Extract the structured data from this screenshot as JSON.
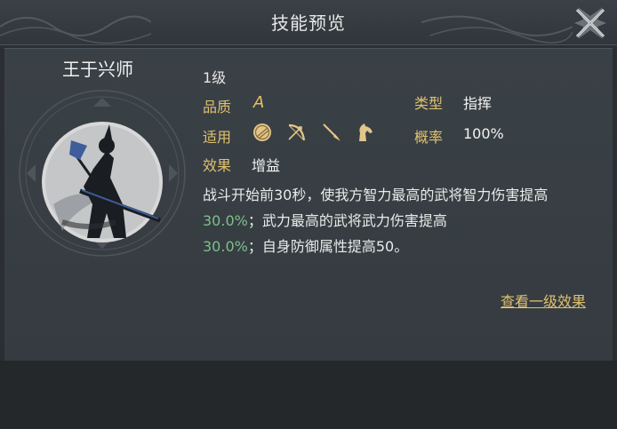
{
  "header": {
    "title": "技能预览"
  },
  "skill": {
    "name": "王于兴师",
    "level": "1级",
    "quality_label": "品质",
    "quality_value": "A",
    "type_label": "类型",
    "type_value": "指挥",
    "applicable_label": "适用",
    "applicable_icons": [
      "shield-icon",
      "bow-icon",
      "spear-icon",
      "horse-icon"
    ],
    "rate_label": "概率",
    "rate_value": "100%",
    "effect_label": "效果",
    "effect_value": "增益",
    "description": {
      "part1": "战斗开始前30秒，使我方智力最高的武将智力伤害提高",
      "hl1": "30.0%",
      "part2": "；武力最高的武将武力伤害提高",
      "hl2": "30.0%",
      "part3": "；自身防御属性提高50。"
    }
  },
  "actions": {
    "view_level_effect": "查看一级效果"
  },
  "colors": {
    "label_gold": "#e0c070",
    "highlight_green": "#7cc08a"
  }
}
